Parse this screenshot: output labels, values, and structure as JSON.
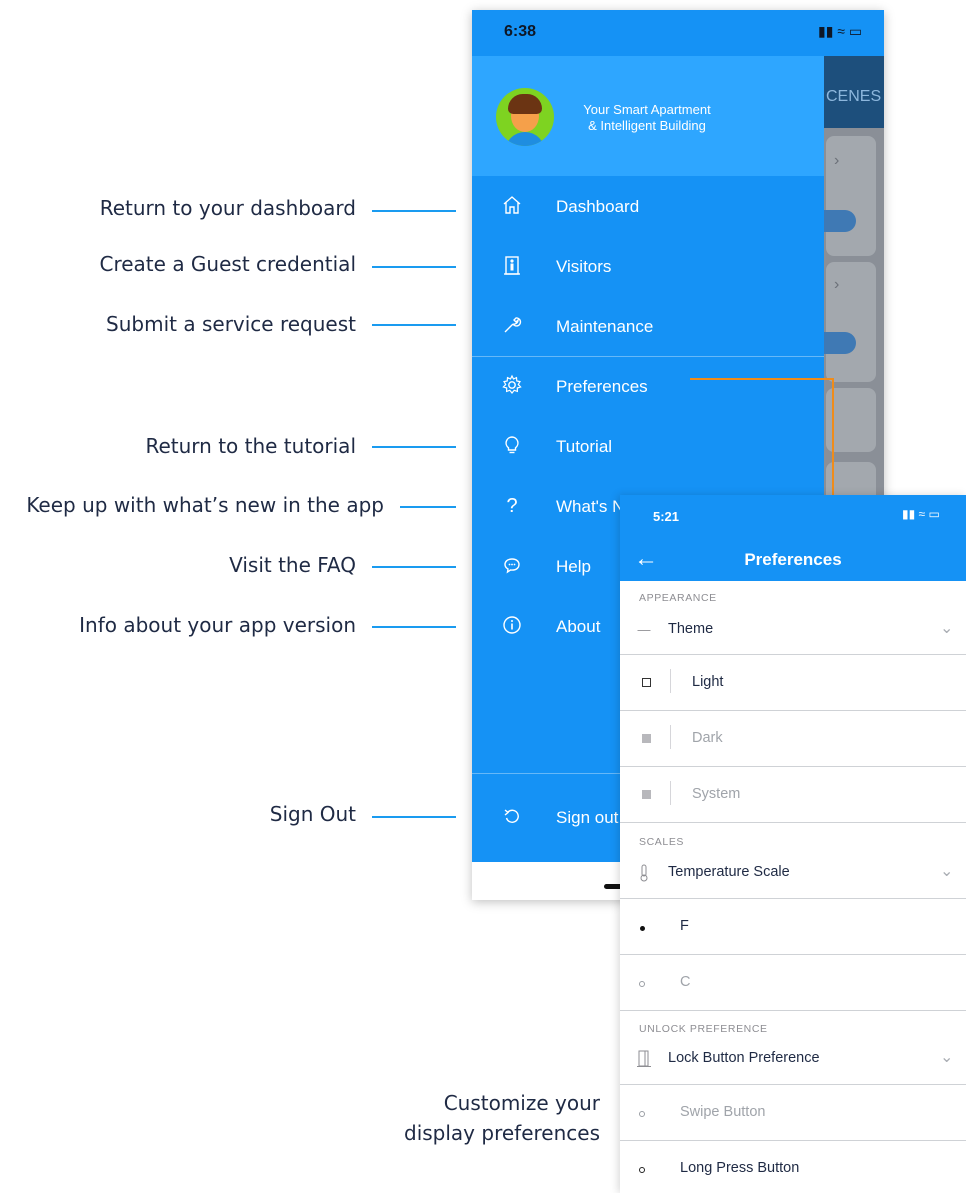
{
  "callouts": [
    {
      "text": "Return to your dashboard"
    },
    {
      "text": "Create a Guest credential"
    },
    {
      "text": "Submit a service request"
    },
    {
      "text": "Return to the tutorial"
    },
    {
      "text": "Keep up with what’s new in the app"
    },
    {
      "text": "Visit the FAQ"
    },
    {
      "text": "Info about your app version"
    },
    {
      "text": "Sign Out"
    }
  ],
  "customize_caption": [
    "Customize your",
    "display preferences"
  ],
  "drawer": {
    "status_time": "6:38",
    "header_line1": "Your Smart Apartment",
    "header_line2": "& Intelligent Building",
    "background_tab_label": "CENES",
    "items": [
      {
        "label": "Dashboard",
        "icon": "home-icon"
      },
      {
        "label": "Visitors",
        "icon": "door-person-icon"
      },
      {
        "label": "Maintenance",
        "icon": "wrench-icon"
      },
      {
        "label": "Preferences",
        "icon": "gear-icon"
      },
      {
        "label": "Tutorial",
        "icon": "lightbulb-icon"
      },
      {
        "label": "What's N",
        "icon": "question-icon"
      },
      {
        "label": "Help",
        "icon": "chat-bubble-icon"
      },
      {
        "label": "About",
        "icon": "info-icon"
      }
    ],
    "sign_out": "Sign out"
  },
  "preferences": {
    "status_time": "5:21",
    "title": "Preferences",
    "sections": {
      "appearance": "APPEARANCE",
      "scales": "SCALES",
      "unlock": "UNLOCK PREFERENCE"
    },
    "theme_label": "Theme",
    "theme_options": [
      "Light",
      "Dark",
      "System"
    ],
    "temp_label": "Temperature Scale",
    "temp_options": [
      "F",
      "C"
    ],
    "lock_label": "Lock Button Preference",
    "lock_options": [
      "Swipe Button",
      "Long Press Button"
    ]
  },
  "colors": {
    "drawer_blue": "#1592f5",
    "header_blue": "#2ea6ff",
    "callout_line": "#1a9bf0",
    "connector_orange": "#f08c1a"
  }
}
